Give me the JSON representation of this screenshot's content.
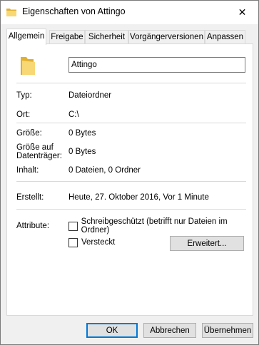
{
  "window": {
    "title": "Eigenschaften von Attingo",
    "close_glyph": "✕"
  },
  "tabs": [
    {
      "label": "Allgemein",
      "active": true
    },
    {
      "label": "Freigabe",
      "active": false
    },
    {
      "label": "Sicherheit",
      "active": false
    },
    {
      "label": "Vorgängerversionen",
      "active": false
    },
    {
      "label": "Anpassen",
      "active": false
    }
  ],
  "general": {
    "folder_name": "Attingo",
    "type_label": "Typ:",
    "type_value": "Dateiordner",
    "location_label": "Ort:",
    "location_value": "C:\\",
    "size_label": "Größe:",
    "size_value": "0 Bytes",
    "size_on_disk_label_line1": "Größe auf",
    "size_on_disk_label_line2": "Datenträger:",
    "size_on_disk_value": "0 Bytes",
    "contents_label": "Inhalt:",
    "contents_value": "0 Dateien, 0 Ordner",
    "created_label": "Erstellt:",
    "created_value": "Heute, 27. Oktober 2016, Vor 1 Minute",
    "attributes_label": "Attribute:",
    "readonly_label": "Schreibgeschützt (betrifft nur Dateien im Ordner)",
    "readonly_checked": false,
    "hidden_label": "Versteckt",
    "hidden_checked": false,
    "advanced_button": "Erweitert..."
  },
  "footer": {
    "ok_label": "OK",
    "cancel_label": "Abbrechen",
    "apply_label": "Übernehmen"
  },
  "colors": {
    "folder_yellow": "#f8d775",
    "folder_dark": "#e0b030",
    "accent": "#0078d7"
  },
  "icons": {
    "title": "folder-icon",
    "big": "folder-icon"
  }
}
